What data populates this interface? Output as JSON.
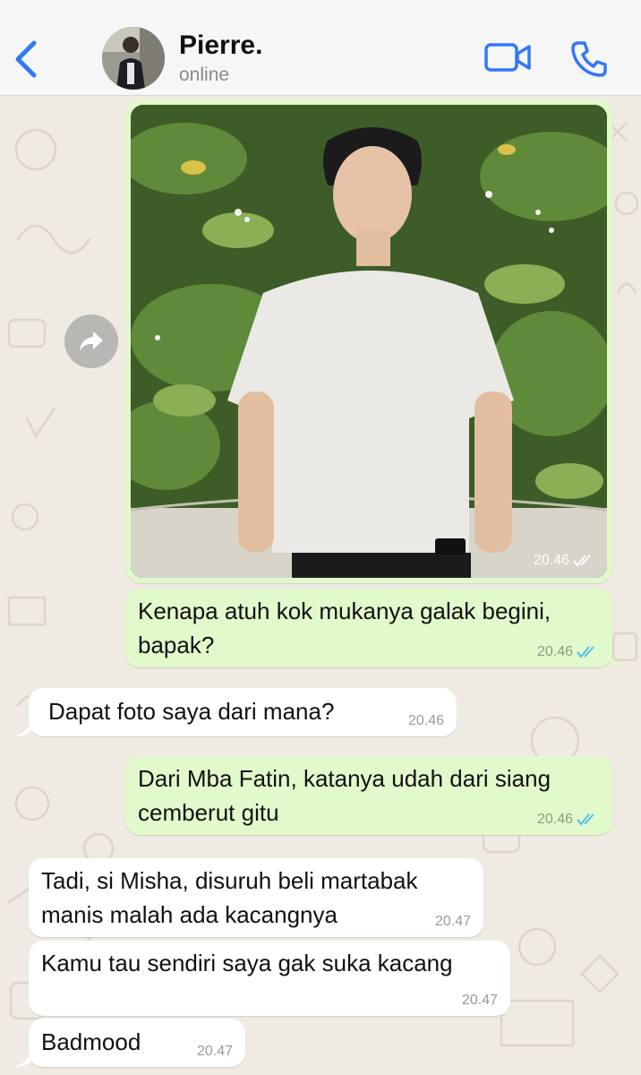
{
  "header": {
    "contact_name": "Pierre.",
    "status": "online"
  },
  "messages": [
    {
      "type": "image",
      "direction": "outgoing",
      "time": "20.46",
      "read": true
    },
    {
      "type": "text",
      "direction": "outgoing",
      "text_lines": [
        "Kenapa atuh kok mukanya galak begini,",
        "bapak?"
      ],
      "time": "20.46",
      "read": true
    },
    {
      "type": "text",
      "direction": "incoming",
      "text_lines": [
        "Dapat foto saya dari mana?"
      ],
      "time": "20.46"
    },
    {
      "type": "text",
      "direction": "outgoing",
      "text_lines": [
        "Dari Mba Fatin, katanya udah dari siang",
        "cemberut gitu"
      ],
      "time": "20.46",
      "read": true
    },
    {
      "type": "text",
      "direction": "incoming",
      "text_lines": [
        "Tadi, si Misha, disuruh beli martabak",
        "manis malah ada kacangnya"
      ],
      "time": "20.47"
    },
    {
      "type": "text",
      "direction": "incoming",
      "text_lines": [
        "Kamu tau sendiri saya gak suka kacang"
      ],
      "time": "20.47"
    },
    {
      "type": "text",
      "direction": "incoming",
      "text_lines": [
        "Badmood"
      ],
      "time": "20.47"
    }
  ],
  "colors": {
    "accent": "#3478f6",
    "outgoing_bubble": "#e2f9cb",
    "incoming_bubble": "#ffffff",
    "chat_background": "#efeae2",
    "read_ticks": "#53bdeb"
  },
  "icons": [
    "back-chevron-icon",
    "video-call-icon",
    "voice-call-icon",
    "forward-icon",
    "double-check-icon"
  ]
}
